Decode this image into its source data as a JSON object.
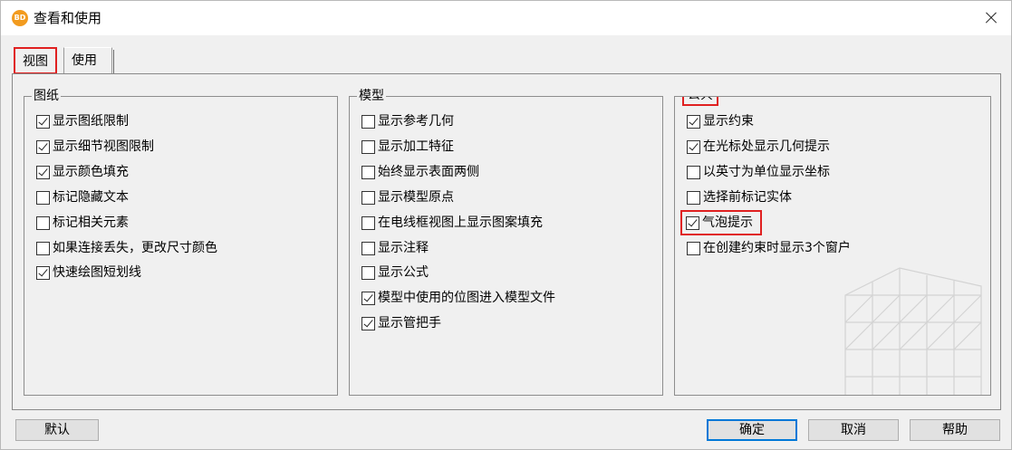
{
  "window": {
    "title": "查看和使用",
    "app_icon": "BD"
  },
  "tabs": [
    {
      "label": "视图"
    },
    {
      "label": "使用"
    }
  ],
  "groups": {
    "paper": {
      "title": "图纸",
      "items": [
        {
          "label": "显示图纸限制",
          "checked": true
        },
        {
          "label": "显示细节视图限制",
          "checked": true
        },
        {
          "label": "显示颜色填充",
          "checked": true
        },
        {
          "label": "标记隐藏文本",
          "checked": false
        },
        {
          "label": "标记相关元素",
          "checked": false
        },
        {
          "label": "如果连接丢失，更改尺寸颜色",
          "checked": false
        },
        {
          "label": "快速绘图短划线",
          "checked": true
        }
      ]
    },
    "model": {
      "title": "模型",
      "items": [
        {
          "label": "显示参考几何",
          "checked": false
        },
        {
          "label": "显示加工特征",
          "checked": false
        },
        {
          "label": "始终显示表面两侧",
          "checked": false
        },
        {
          "label": "显示模型原点",
          "checked": false
        },
        {
          "label": "在电线框视图上显示图案填充",
          "checked": false
        },
        {
          "label": "显示注释",
          "checked": false
        },
        {
          "label": "显示公式",
          "checked": false
        },
        {
          "label": "模型中使用的位图进入模型文件",
          "checked": true
        },
        {
          "label": "显示管把手",
          "checked": true
        }
      ]
    },
    "common": {
      "title": "公共",
      "items": [
        {
          "label": "显示约束",
          "checked": true
        },
        {
          "label": "在光标处显示几何提示",
          "checked": true
        },
        {
          "label": "以英寸为单位显示坐标",
          "checked": false
        },
        {
          "label": "选择前标记实体",
          "checked": false
        },
        {
          "label": "气泡提示",
          "checked": true
        },
        {
          "label": "在创建约束时显示3个窗户",
          "checked": false
        }
      ]
    }
  },
  "buttons": {
    "default": "默认",
    "ok": "确定",
    "cancel": "取消",
    "help": "帮助"
  },
  "colors": {
    "highlight": "#e02020",
    "focus_border": "#0078d7",
    "app_icon": "#f29b1f"
  }
}
